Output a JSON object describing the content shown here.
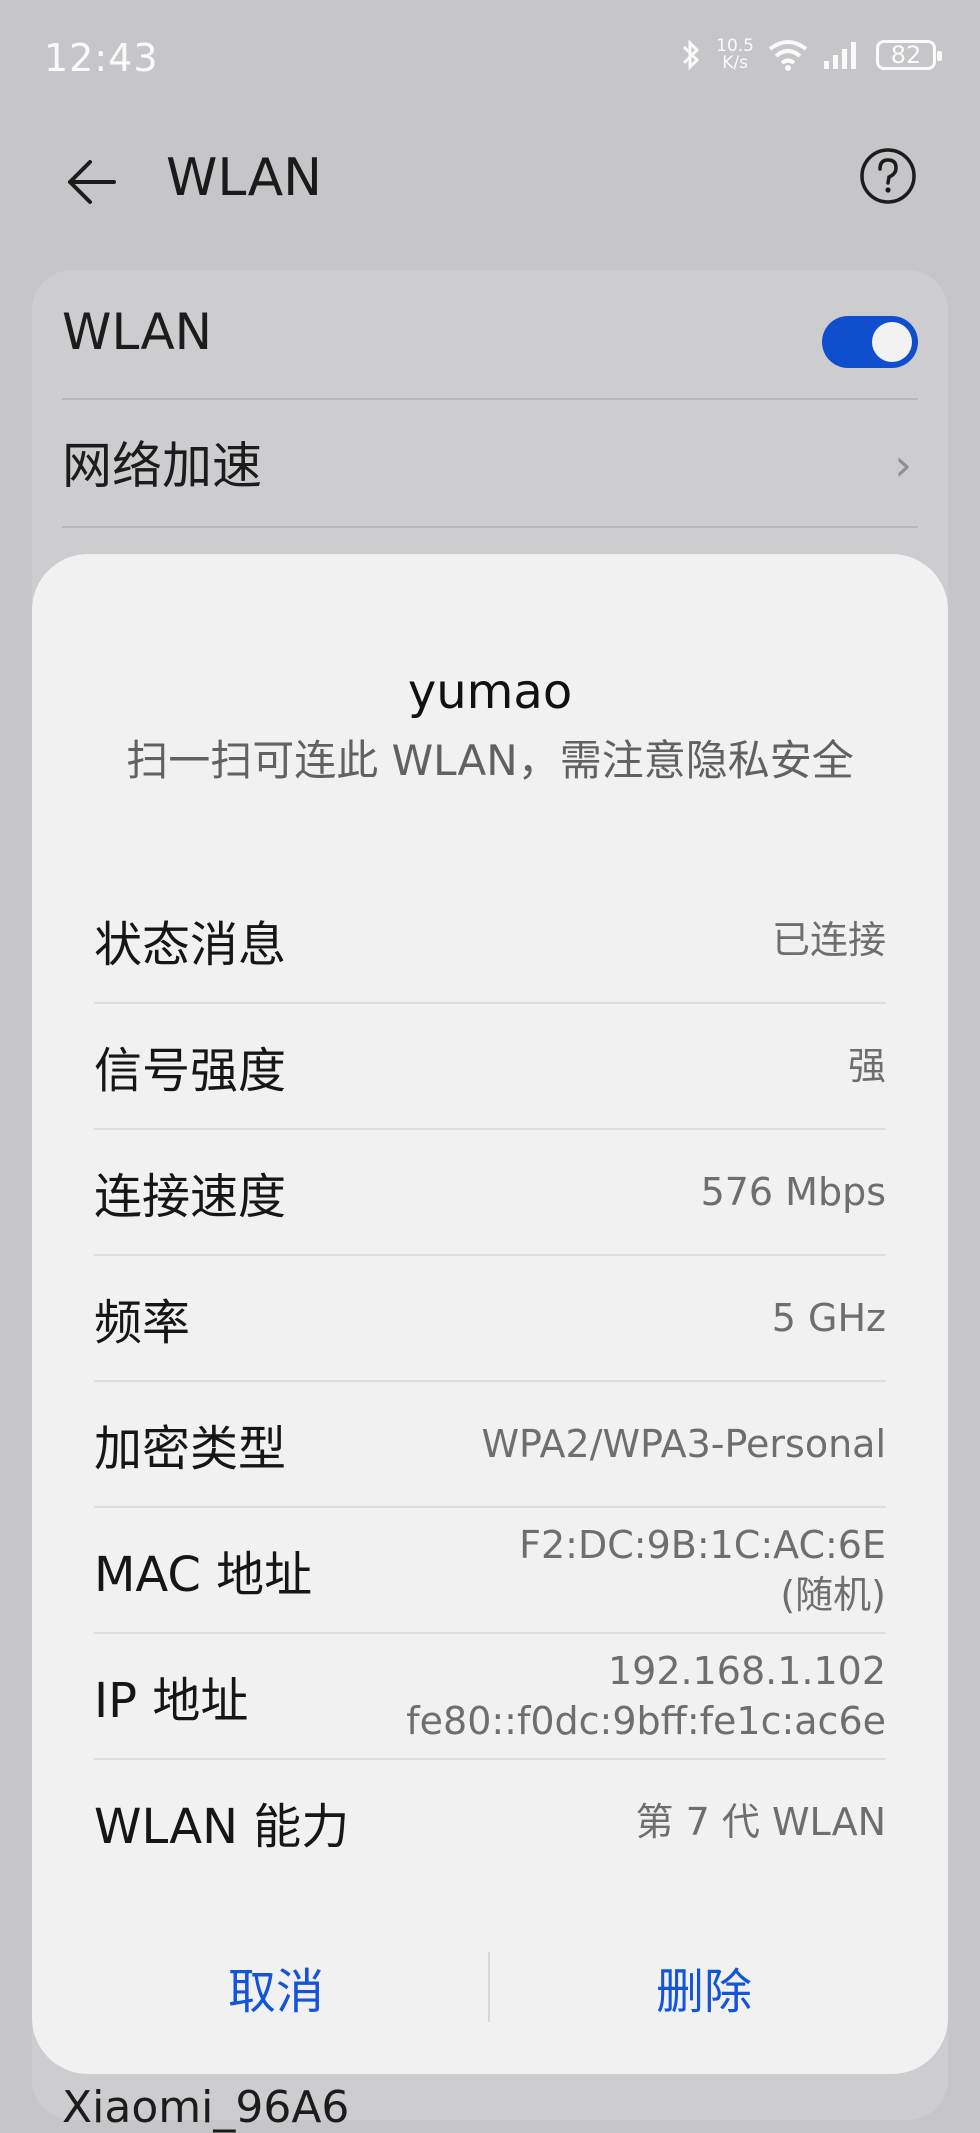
{
  "status_bar": {
    "time": "12:43",
    "speed_value": "10.5",
    "speed_unit": "K/s",
    "battery": "82",
    "icons": [
      "bluetooth-icon",
      "wifi-icon",
      "signal-icon",
      "battery-icon"
    ]
  },
  "header": {
    "title": "WLAN"
  },
  "settings": {
    "wlan_label": "WLAN",
    "wlan_enabled": true,
    "accel_label": "网络加速",
    "next_network": "Xiaomi_96A6"
  },
  "dialog": {
    "ssid": "yumao",
    "scan_tip": "扫一扫可连此 WLAN，需注意隐私安全",
    "rows": [
      {
        "key": "状态消息",
        "value": "已连接"
      },
      {
        "key": "信号强度",
        "value": "强"
      },
      {
        "key": "连接速度",
        "value": "576 Mbps"
      },
      {
        "key": "频率",
        "value": "5 GHz"
      },
      {
        "key": "加密类型",
        "value": "WPA2/WPA3-Personal"
      },
      {
        "key": "MAC 地址",
        "value": "F2:DC:9B:1C:AC:6E",
        "value2": "(随机)"
      },
      {
        "key": "IP 地址",
        "value": "192.168.1.102",
        "value2": "fe80::f0dc:9bff:fe1c:ac6e"
      },
      {
        "key": "WLAN 能力",
        "value": "第 7 代 WLAN"
      }
    ],
    "cancel_label": "取消",
    "delete_label": "删除"
  },
  "colors": {
    "accent": "#1354d8",
    "toggle": "#0f4ecc"
  }
}
